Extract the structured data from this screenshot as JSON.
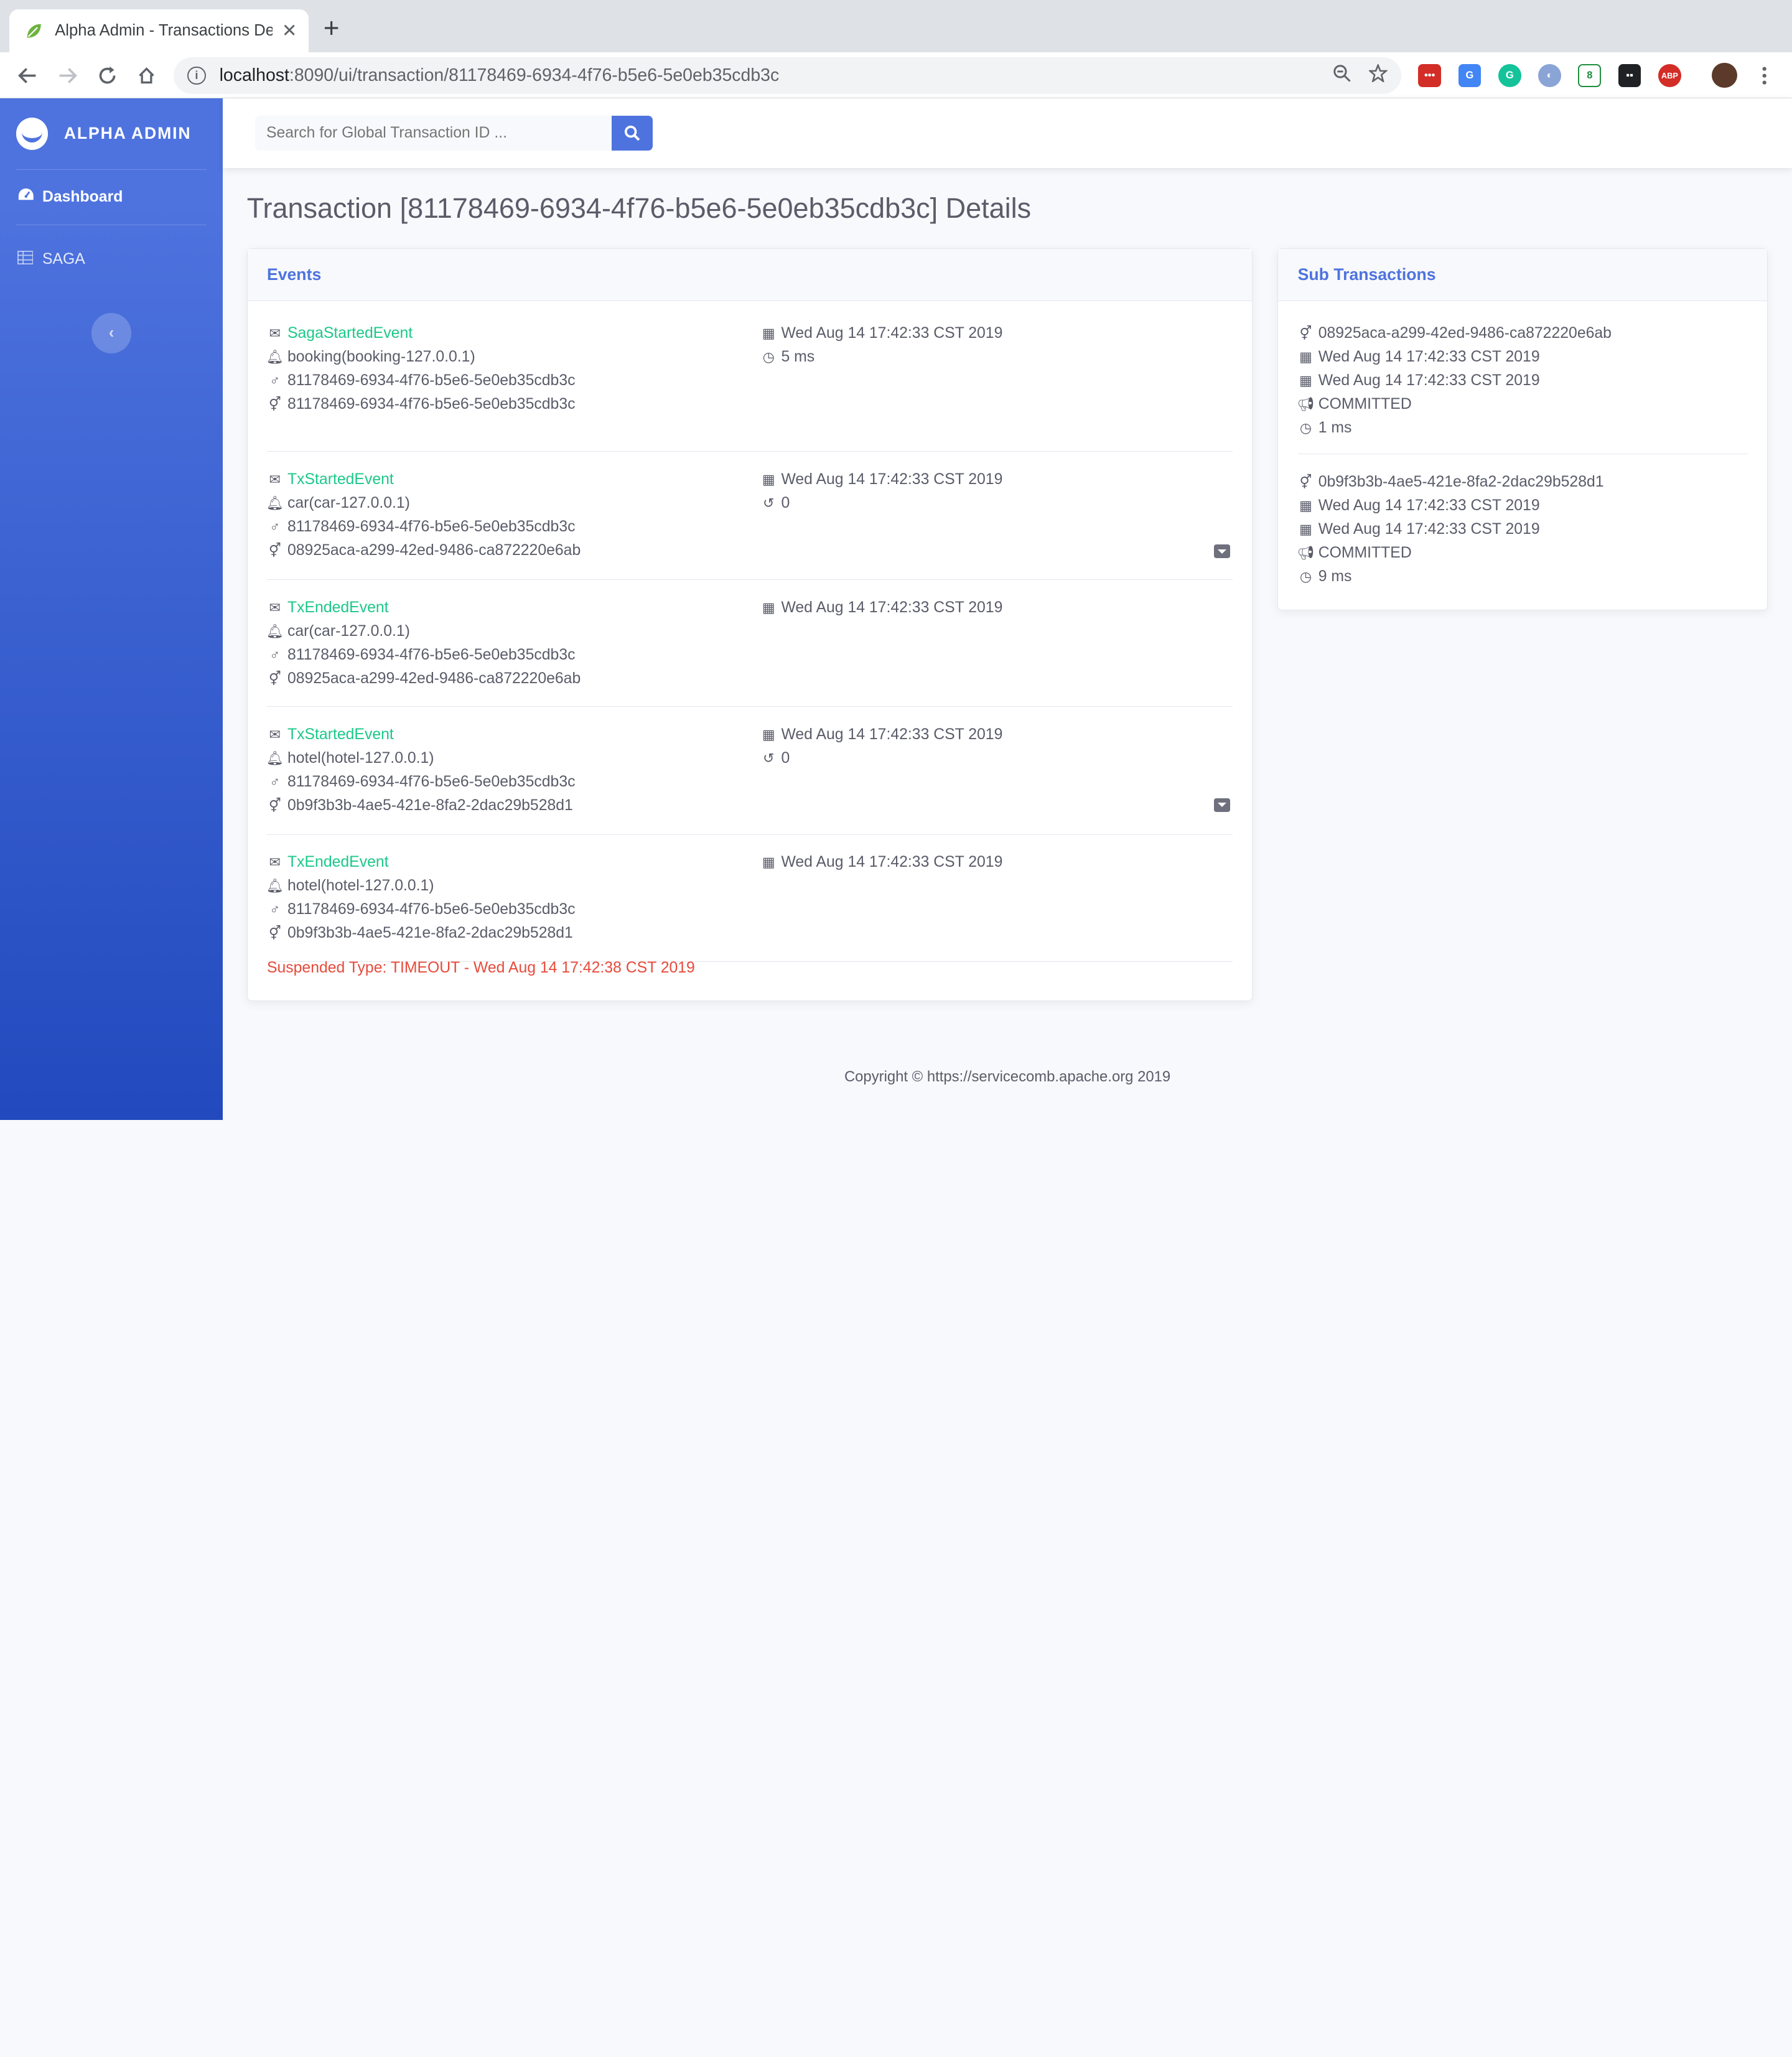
{
  "browser": {
    "tab_title": "Alpha Admin - Transactions De",
    "url_host": "localhost",
    "url_rest": ":8090/ui/transaction/81178469-6934-4f76-b5e6-5e0eb35cdb3c",
    "extensions": [
      "lastpass",
      "google-translate",
      "grammarly",
      "ext-4",
      "ext-5",
      "ext-6",
      "adblock-plus"
    ],
    "adblock_label": "ABP"
  },
  "sidebar": {
    "brand": "ALPHA ADMIN",
    "items": [
      {
        "label": "Dashboard",
        "icon": "dashboard-icon"
      },
      {
        "label": "SAGA",
        "icon": "table-icon"
      }
    ],
    "toggle_glyph": "‹"
  },
  "topbar": {
    "search_placeholder": "Search for Global Transaction ID ..."
  },
  "page": {
    "title": "Transaction [81178469-6934-4f76-b5e6-5e0eb35cdb3c] Details"
  },
  "events": {
    "header": "Events",
    "items": [
      {
        "type": "SagaStartedEvent",
        "service": "booking(booking-127.0.0.1)",
        "global_id": "81178469-6934-4f76-b5e6-5e0eb35cdb3c",
        "local_id": "81178469-6934-4f76-b5e6-5e0eb35cdb3c",
        "time": "Wed Aug 14 17:42:33 CST 2019",
        "extra": "5 ms",
        "extra_icon": "clock-icon"
      },
      {
        "type": "TxStartedEvent",
        "service": "car(car-127.0.0.1)",
        "global_id": "81178469-6934-4f76-b5e6-5e0eb35cdb3c",
        "local_id": "08925aca-a299-42ed-9486-ca872220e6ab",
        "time": "Wed Aug 14 17:42:33 CST 2019",
        "extra": "0",
        "extra_icon": "retry-icon"
      },
      {
        "type": "TxEndedEvent",
        "service": "car(car-127.0.0.1)",
        "global_id": "81178469-6934-4f76-b5e6-5e0eb35cdb3c",
        "local_id": "08925aca-a299-42ed-9486-ca872220e6ab",
        "time": "Wed Aug 14 17:42:33 CST 2019"
      },
      {
        "type": "TxStartedEvent",
        "service": "hotel(hotel-127.0.0.1)",
        "global_id": "81178469-6934-4f76-b5e6-5e0eb35cdb3c",
        "local_id": "0b9f3b3b-4ae5-421e-8fa2-2dac29b528d1",
        "time": "Wed Aug 14 17:42:33 CST 2019",
        "extra": "0",
        "extra_icon": "retry-icon"
      },
      {
        "type": "TxEndedEvent",
        "service": "hotel(hotel-127.0.0.1)",
        "global_id": "81178469-6934-4f76-b5e6-5e0eb35cdb3c",
        "local_id": "0b9f3b3b-4ae5-421e-8fa2-2dac29b528d1",
        "time": "Wed Aug 14 17:42:33 CST 2019"
      }
    ],
    "suspended": "Suspended Type: TIMEOUT - Wed Aug 14 17:42:38 CST 2019"
  },
  "subtransactions": {
    "header": "Sub Transactions",
    "items": [
      {
        "local_id": "08925aca-a299-42ed-9486-ca872220e6ab",
        "begin": "Wed Aug 14 17:42:33 CST 2019",
        "end": "Wed Aug 14 17:42:33 CST 2019",
        "state": "COMMITTED",
        "duration": "1 ms"
      },
      {
        "local_id": "0b9f3b3b-4ae5-421e-8fa2-2dac29b528d1",
        "begin": "Wed Aug 14 17:42:33 CST 2019",
        "end": "Wed Aug 14 17:42:33 CST 2019",
        "state": "COMMITTED",
        "duration": "9 ms"
      }
    ]
  },
  "footer": {
    "text": "Copyright © https://servicecomb.apache.org 2019"
  },
  "colors": {
    "primary": "#4e73df",
    "success": "#1cc88a",
    "danger": "#e74a3b"
  }
}
